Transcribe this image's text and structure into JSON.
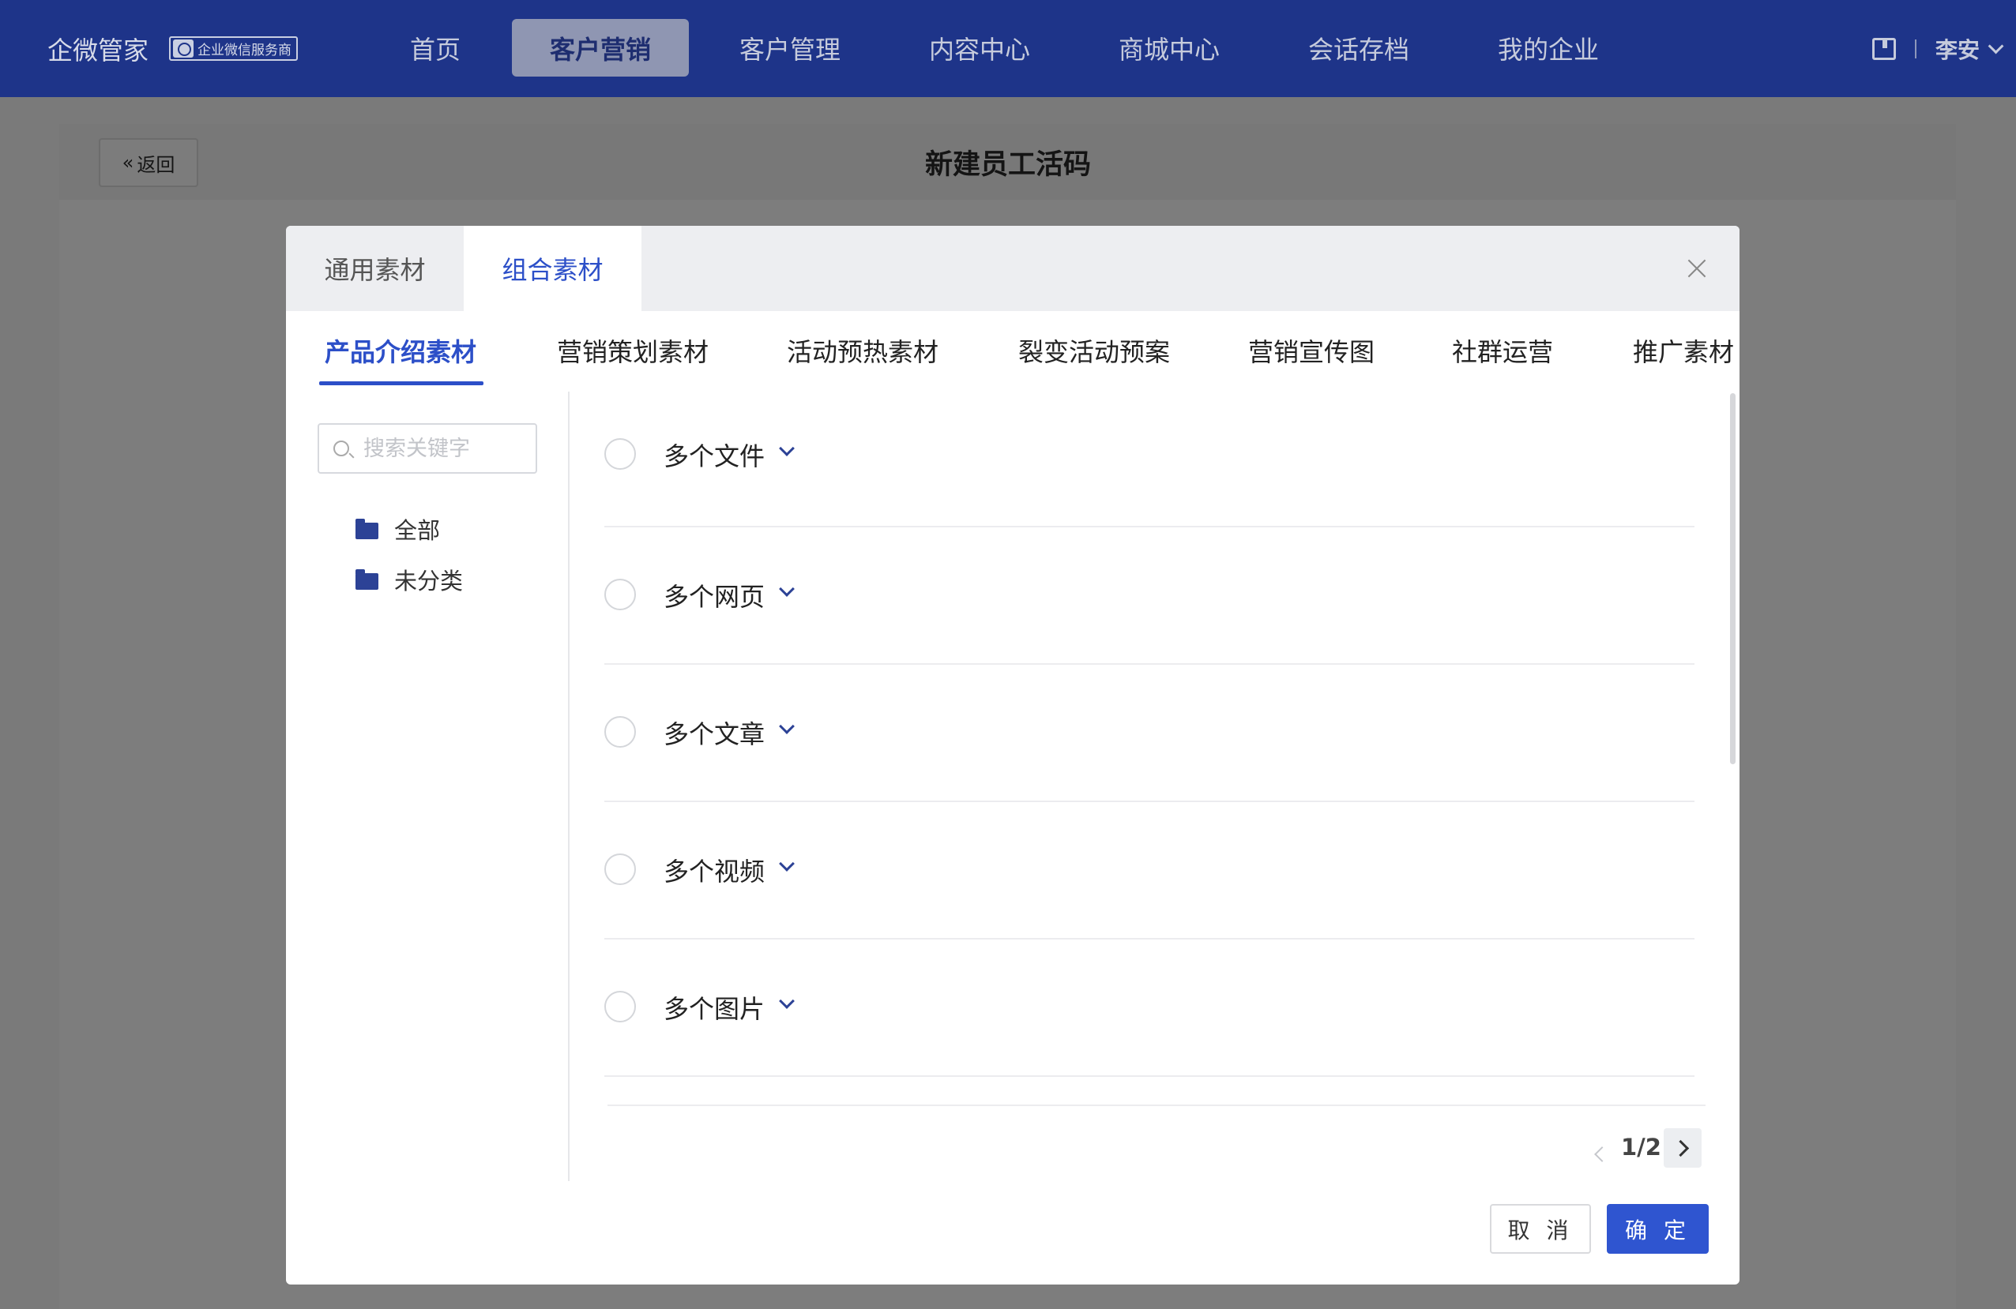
{
  "header": {
    "brand": "企微管家",
    "badge": "企业微信服务商",
    "nav": [
      "首页",
      "客户营销",
      "客户管理",
      "内容中心",
      "商城中心",
      "会话存档",
      "我的企业"
    ],
    "user": "李安"
  },
  "page": {
    "back_label": "返回",
    "title": "新建员工活码"
  },
  "modal": {
    "tabs": [
      "通用素材",
      "组合素材"
    ],
    "categories": [
      "产品介绍素材",
      "营销策划素材",
      "活动预热素材",
      "裂变活动预案",
      "营销宣传图",
      "社群运营",
      "推广素材"
    ],
    "search_placeholder": "搜索关键字",
    "folders": [
      "全部",
      "未分类"
    ],
    "materials": [
      "多个文件",
      "多个网页",
      "多个文章",
      "多个视频",
      "多个图片"
    ],
    "pager": "1/2",
    "cancel_label": "取 消",
    "ok_label": "确 定"
  },
  "colors": {
    "nav_bg": "#1e3489",
    "accent": "#2c4fc8",
    "primary_button": "#2f55d0"
  },
  "icons": {
    "back": "double-chevron-left-icon",
    "close": "close-icon",
    "search": "search-icon",
    "folder": "folder-icon",
    "expand": "chevron-down-icon",
    "help": "book-icon"
  }
}
